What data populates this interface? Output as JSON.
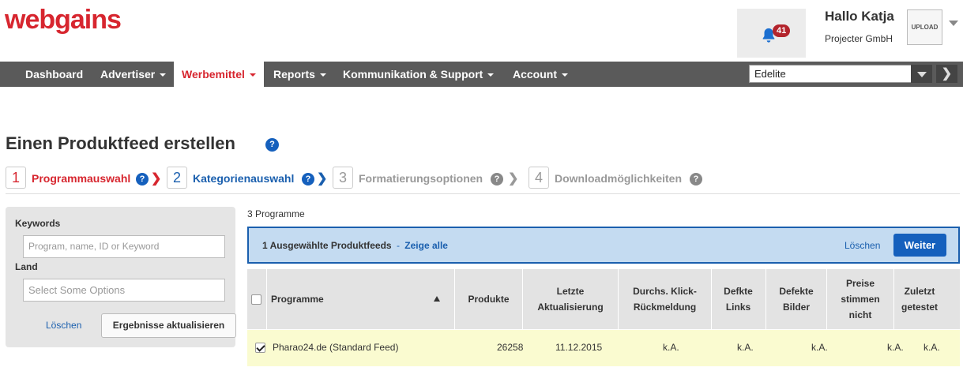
{
  "header": {
    "logo": "webgains",
    "notifications_count": "41",
    "greeting": "Hallo Katja",
    "company": "Projecter GmbH",
    "avatar_text": "UPLOAD"
  },
  "nav": {
    "items": [
      {
        "label": "Dashboard",
        "has_caret": false
      },
      {
        "label": "Advertiser",
        "has_caret": true
      },
      {
        "label": "Werbemittel",
        "has_caret": true,
        "active": true
      },
      {
        "label": "Reports",
        "has_caret": true
      },
      {
        "label": "Kommunikation & Support",
        "has_caret": true
      },
      {
        "label": "Account",
        "has_caret": true
      }
    ],
    "program_select": "Edelite",
    "go_label": "❯"
  },
  "page": {
    "title": "Einen Produktfeed erstellen"
  },
  "steps": [
    {
      "num": "1",
      "label": "Programmauswahl"
    },
    {
      "num": "2",
      "label": "Kategorienauswahl"
    },
    {
      "num": "3",
      "label": "Formatierungsoptionen"
    },
    {
      "num": "4",
      "label": "Downloadmöglichkeiten"
    }
  ],
  "filter": {
    "keywords_label": "Keywords",
    "keywords_placeholder": "Program, name, ID or Keyword",
    "land_label": "Land",
    "land_placeholder": "Select Some Options",
    "clear_label": "Löschen",
    "update_label": "Ergebnisse aktualisieren"
  },
  "results": {
    "count_text": "3 Programme",
    "selection_text": "1 Ausgewählte Produktfeeds",
    "show_all": "Zeige alle",
    "separator": "-",
    "clear_label": "Löschen",
    "next_label": "Weiter",
    "columns": [
      "Programme",
      "Produkte",
      "Letzte\nAktualisierung",
      "Durchs. Klick-\nRückmeldung",
      "Defkte\nLinks",
      "Defekte\nBilder",
      "Preise\nstimmen\nnicht",
      "Zuletzt\ngetestet"
    ],
    "rows": [
      {
        "checked": true,
        "program": "Pharao24.de (Standard Feed)",
        "products": "26258",
        "last_update": "11.12.2015",
        "click_feedback": "k.A.",
        "broken_links": "k.A.",
        "broken_images": "k.A.",
        "price_mismatch": "k.A.",
        "last_tested": "k.A."
      }
    ]
  },
  "colors": {
    "brand_red": "#d7262f",
    "nav_bg": "#5a5a5a",
    "link_blue": "#1a5fae",
    "primary_button": "#1560bd",
    "selection_bar": "#c4dbf1",
    "row_highlight": "#fafbd0"
  }
}
